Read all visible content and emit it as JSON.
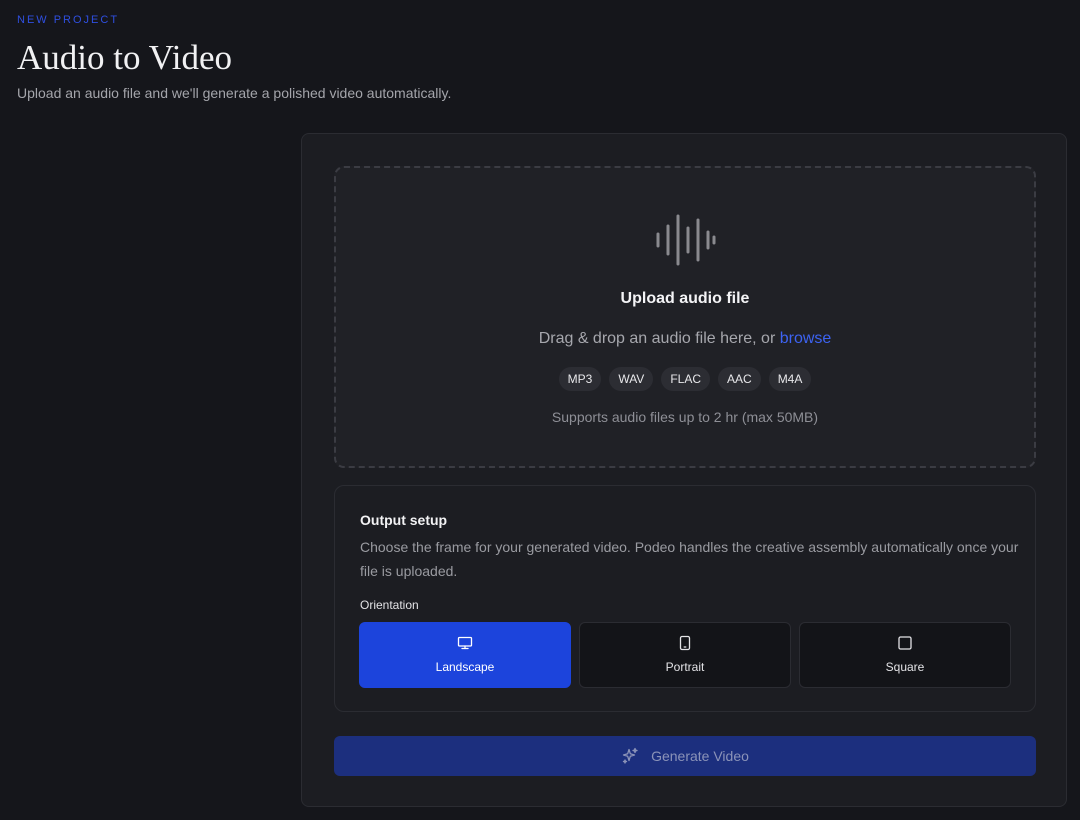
{
  "header": {
    "eyebrow": "NEW PROJECT",
    "title": "Audio to Video",
    "subtitle": "Upload an audio file and we'll generate a polished video automatically."
  },
  "upload": {
    "icon": "audio-waveform-icon",
    "title": "Upload audio file",
    "hint_prefix": "Drag & drop an audio file here, or",
    "browse_label": "browse",
    "formats": [
      "MP3",
      "WAV",
      "FLAC",
      "AAC",
      "M4A"
    ],
    "size_note": "Supports audio files up to 2 hr (max 50MB)"
  },
  "output": {
    "title": "Output setup",
    "description": "Choose the frame for your generated video. Podeo handles the creative assembly automatically once your file is uploaded.",
    "orientation_label": "Orientation",
    "options": [
      {
        "label": "Landscape",
        "icon": "monitor-icon",
        "selected": true
      },
      {
        "label": "Portrait",
        "icon": "phone-icon",
        "selected": false
      },
      {
        "label": "Square",
        "icon": "square-icon",
        "selected": false
      }
    ]
  },
  "generate": {
    "label": "Generate Video",
    "icon": "sparkle-icon",
    "enabled": false
  },
  "colors": {
    "accent": "#1c44dc",
    "link": "#3d63f2",
    "background": "#15161b"
  }
}
